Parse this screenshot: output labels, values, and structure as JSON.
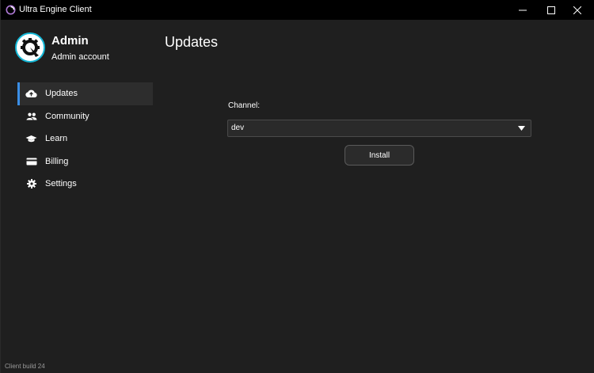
{
  "window": {
    "title": "Ultra Engine Client",
    "controls": [
      "minimize-icon",
      "maximize-icon",
      "close-icon"
    ]
  },
  "profile": {
    "name": "Admin",
    "subtitle": "Admin account",
    "avatar_icon": "engine-logo-icon",
    "avatar_ring_color": "#14b7d6"
  },
  "sidebar": {
    "items": [
      {
        "label": "Updates",
        "icon": "cloud-upload-icon",
        "active": true
      },
      {
        "label": "Community",
        "icon": "people-icon",
        "active": false
      },
      {
        "label": "Learn",
        "icon": "graduation-cap-icon",
        "active": false
      },
      {
        "label": "Billing",
        "icon": "credit-card-icon",
        "active": false
      },
      {
        "label": "Settings",
        "icon": "gear-icon",
        "active": false
      }
    ],
    "accent_color": "#3a8ee6"
  },
  "main": {
    "title": "Updates",
    "channel_label": "Channel:",
    "channel_value": "dev",
    "install_label": "Install"
  },
  "footer": {
    "build": "Client build 24"
  }
}
